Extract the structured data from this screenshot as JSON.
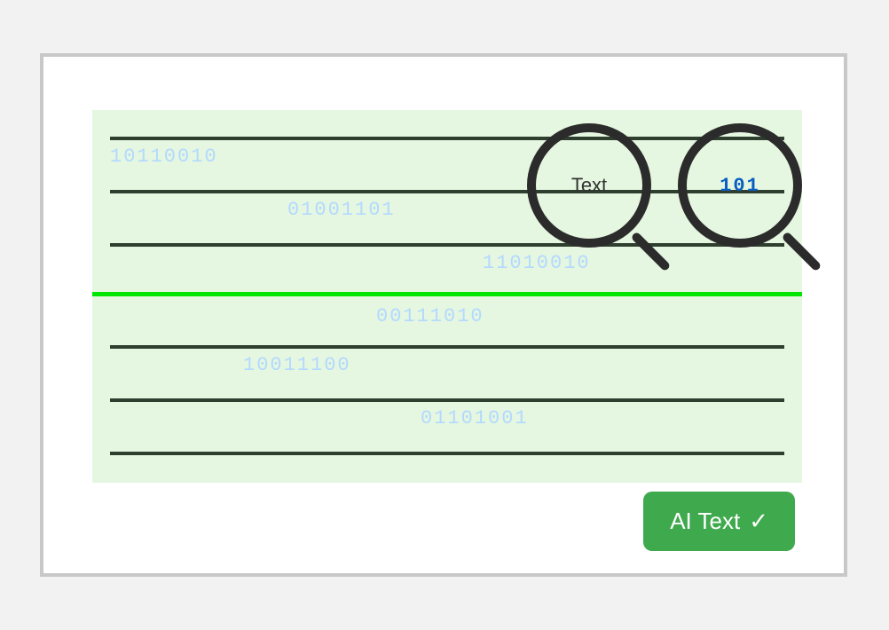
{
  "binary": {
    "b1": "10110010",
    "b2": "01001101",
    "b3": "11010010",
    "b4": "00111010",
    "b5": "10011100",
    "b6": "01101001"
  },
  "magnifiers": {
    "text_label": "Text",
    "code_label": "101"
  },
  "button": {
    "label": "AI Text",
    "check": "✓"
  }
}
